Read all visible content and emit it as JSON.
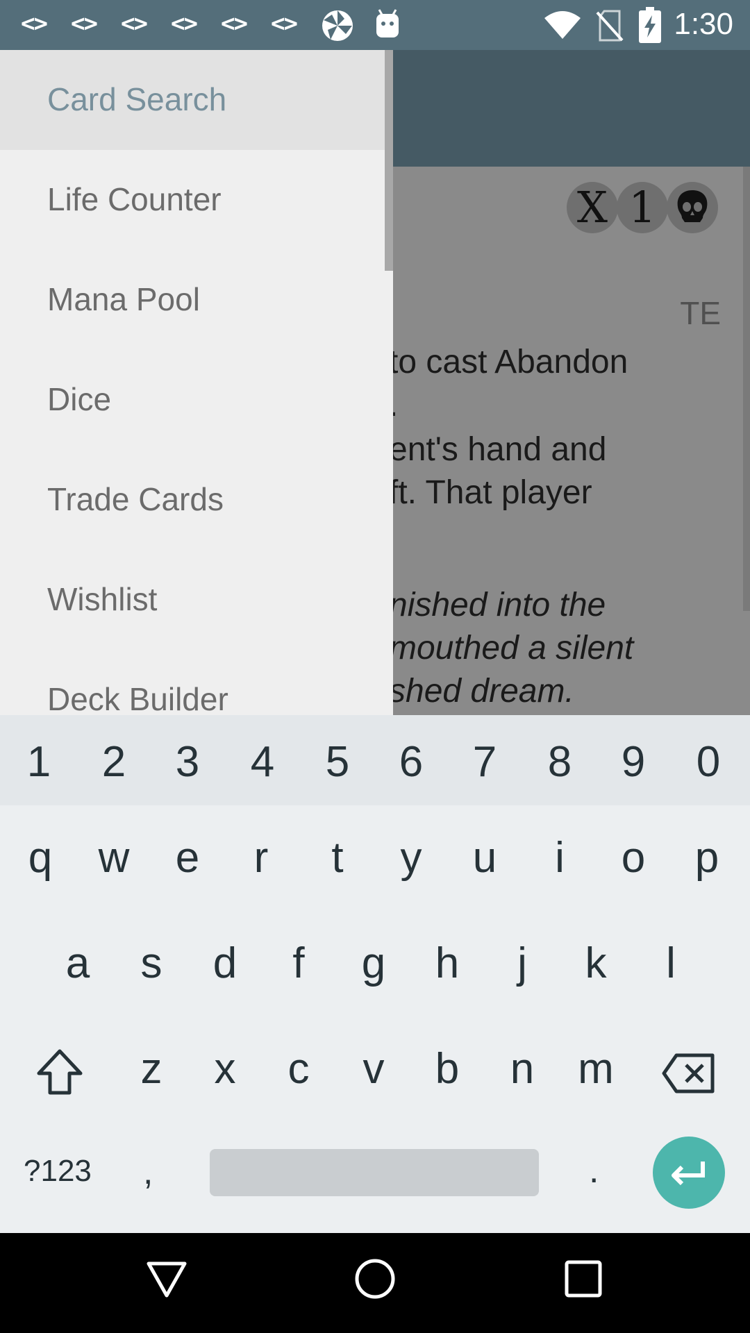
{
  "status_bar": {
    "code_icons": [
      "<>",
      "<>",
      "<>",
      "<>",
      "<>",
      "<>"
    ],
    "time": "1:30",
    "icons": [
      "code-icon",
      "pinwheel-icon",
      "android-icon",
      "wifi-icon",
      "no-sim-icon",
      "battery-charging-icon"
    ]
  },
  "card": {
    "mana_symbols": [
      "X",
      "1"
    ],
    "set_code": "TE",
    "text_lines": [
      "to cast Abandon",
      ".",
      "ent's hand and",
      "ft. That player"
    ],
    "flavor_lines": [
      "nished into the",
      " mouthed a silent",
      "shed dream."
    ]
  },
  "drawer": {
    "items": [
      {
        "label": "Card Search",
        "active": true
      },
      {
        "label": "Life Counter",
        "active": false
      },
      {
        "label": "Mana Pool",
        "active": false
      },
      {
        "label": "Dice",
        "active": false
      },
      {
        "label": "Trade Cards",
        "active": false
      },
      {
        "label": "Wishlist",
        "active": false
      },
      {
        "label": "Deck Builder",
        "active": false
      }
    ]
  },
  "keyboard": {
    "numbers": [
      "1",
      "2",
      "3",
      "4",
      "5",
      "6",
      "7",
      "8",
      "9",
      "0"
    ],
    "row1": [
      "q",
      "w",
      "e",
      "r",
      "t",
      "y",
      "u",
      "i",
      "o",
      "p"
    ],
    "row2": [
      "a",
      "s",
      "d",
      "f",
      "g",
      "h",
      "j",
      "k",
      "l"
    ],
    "row3": [
      "z",
      "x",
      "c",
      "v",
      "b",
      "n",
      "m"
    ],
    "symbols_label": "?123",
    "comma": ",",
    "period": ".",
    "accent_color": "#4db6ac"
  },
  "colors": {
    "status_bar": "#546e7a",
    "toolbar": "#455a64",
    "drawer_active_text": "#78909c"
  }
}
